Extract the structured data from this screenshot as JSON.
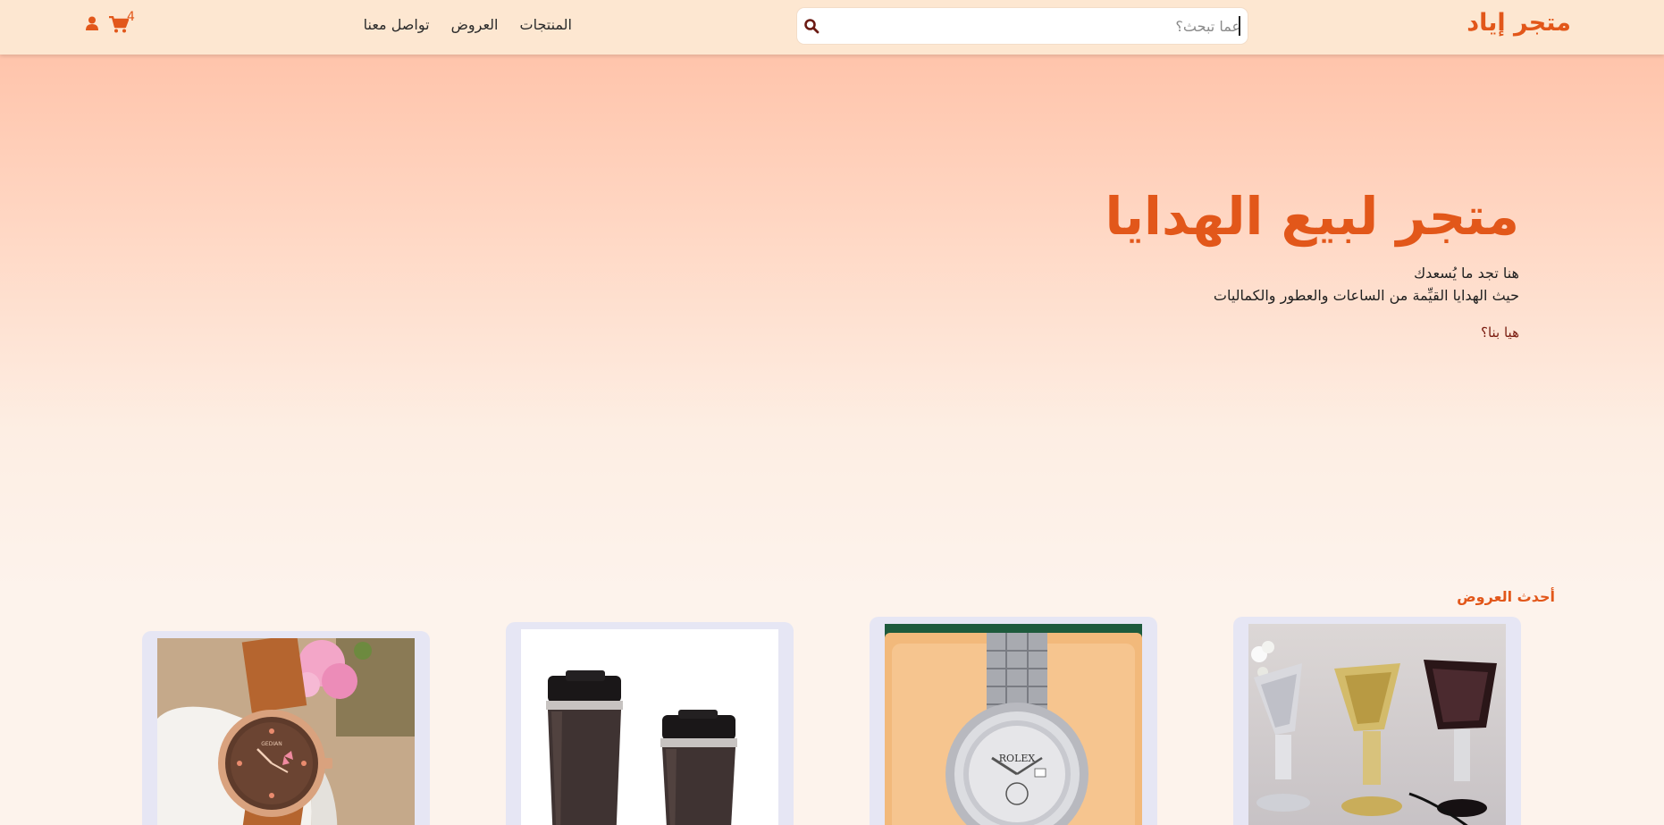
{
  "navbar": {
    "brand": "متجر إياد",
    "search": {
      "placeholder": "عما تبحث؟"
    },
    "links": [
      "المنتجات",
      "العروض",
      "تواصل معنا"
    ],
    "cart_count": "4"
  },
  "hero": {
    "title": "متجر لبيع الهدايا",
    "line1": "هنا تجد ما يُسعدك",
    "line2": "حيث الهدايا القيِّمة من الساعات والعطور والكماليات",
    "cta": "هيا بنا؟"
  },
  "offers": {
    "title": "أحدث العروض",
    "products": [
      {
        "kind": "incense-burners"
      },
      {
        "kind": "rolex-watch"
      },
      {
        "kind": "travel-mugs"
      },
      {
        "kind": "leather-watch"
      }
    ]
  },
  "colors": {
    "accent": "#e2571a",
    "nav_bg": "#fde7d1",
    "card_bg": "#e6e6f4"
  }
}
